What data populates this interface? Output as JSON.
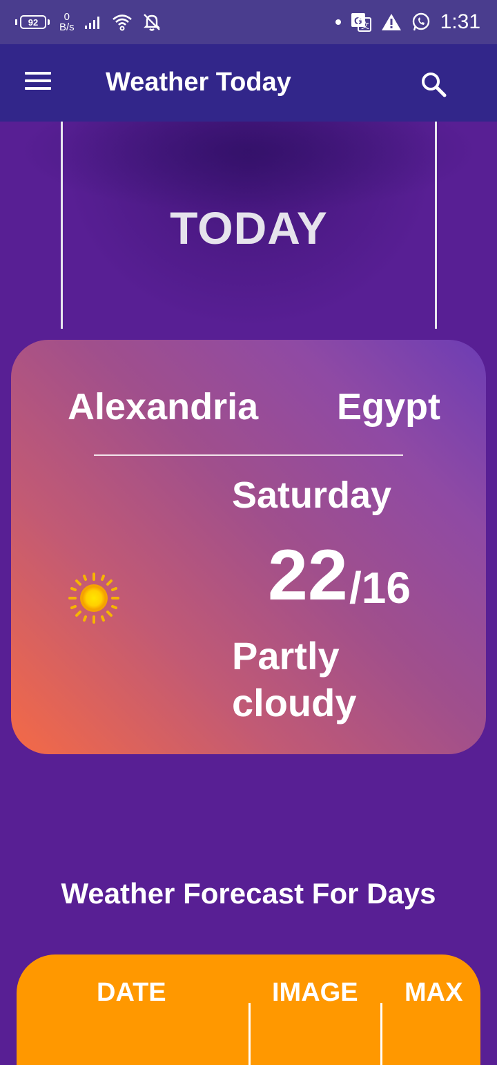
{
  "status_bar": {
    "battery": "92",
    "net_speed_value": "0",
    "net_speed_unit": "B/s",
    "time": "1:31",
    "icons": [
      "signal-icon",
      "wifi-icon",
      "notifications-off-icon",
      "dot-icon",
      "translate-icon",
      "warning-icon",
      "whatsapp-icon"
    ]
  },
  "app_bar": {
    "title": "Weather Today",
    "menu_icon": "hamburger-menu-icon",
    "search_icon": "search-icon"
  },
  "today": {
    "label": "TODAY"
  },
  "card": {
    "city": "Alexandria",
    "country": "Egypt",
    "day": "Saturday",
    "temp_max": "22",
    "temp_min": "/16",
    "condition": "Partly cloudy",
    "icon": "sun-icon"
  },
  "forecast": {
    "title": "Weather Forecast For Days",
    "columns": [
      "DATE",
      "IMAGE",
      "MAX"
    ]
  },
  "colors": {
    "status_bar": "#4a3d8e",
    "app_bar": "#32268a",
    "background": "#581f94",
    "table": "#ff9800"
  }
}
